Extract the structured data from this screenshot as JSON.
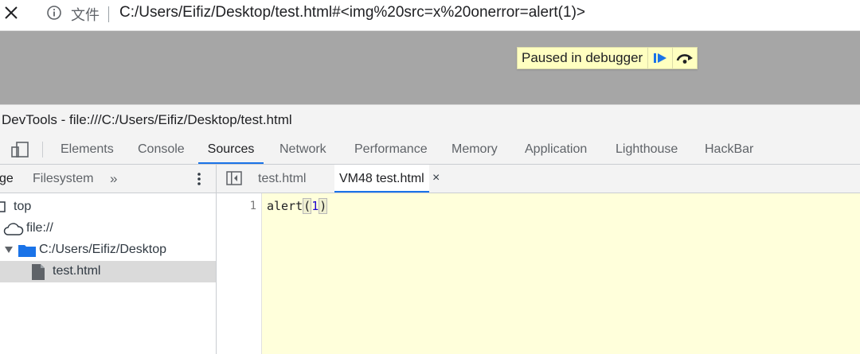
{
  "browser": {
    "url_prefix": "文件",
    "url": "C:/Users/Eifiz/Desktop/test.html#<img%20src=x%20onerror=alert(1)>"
  },
  "debugger_overlay": {
    "message": "Paused in debugger",
    "resume_icon": "resume-icon",
    "step_over_icon": "step-over-icon"
  },
  "devtools": {
    "title": "DevTools - file:///C:/Users/Eifiz/Desktop/test.html",
    "tabs": [
      "Elements",
      "Console",
      "Sources",
      "Network",
      "Performance",
      "Memory",
      "Application",
      "Lighthouse",
      "HackBar"
    ],
    "active_tab": "Sources",
    "accent_color": "#1a73e8"
  },
  "navigator": {
    "tabs": [
      "ge",
      "Filesystem"
    ],
    "more": "»",
    "tree": [
      "top",
      "file://",
      "C:/Users/Eifiz/Desktop",
      "test.html"
    ],
    "selected": "test.html"
  },
  "editor": {
    "tabs": [
      "test.html",
      "VM48 test.html"
    ],
    "active_tab": "VM48 test.html",
    "close": "×",
    "line_number": "1",
    "code_fn": "alert",
    "code_open": "(",
    "code_arg": "1",
    "code_close": ")"
  }
}
